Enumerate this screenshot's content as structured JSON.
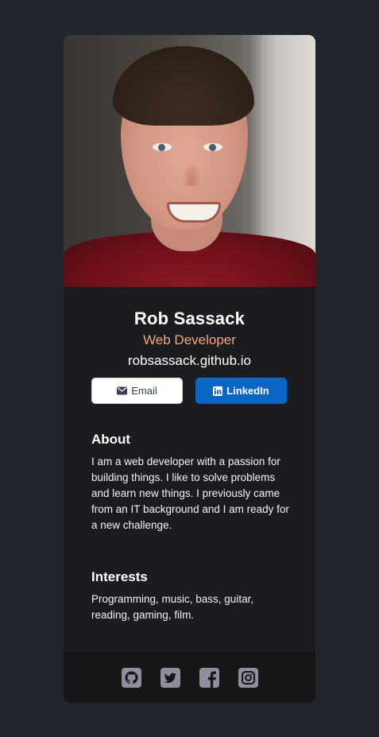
{
  "profile": {
    "name": "Rob Sassack",
    "title": "Web Developer",
    "website": "robsassack.github.io"
  },
  "buttons": {
    "email_label": "Email",
    "email_icon": "envelope-icon",
    "linkedin_label": "LinkedIn",
    "linkedin_icon": "linkedin-icon"
  },
  "about": {
    "heading": "About",
    "text": "I am a web developer with a passion for building things. I like to solve problems and learn new things. I previously came from an IT background and I am ready for a new challenge."
  },
  "interests": {
    "heading": "Interests",
    "text": "Programming, music, bass, guitar, reading, gaming, film."
  },
  "footer": {
    "icons": [
      "github-icon",
      "twitter-icon",
      "facebook-icon",
      "instagram-icon"
    ]
  },
  "colors": {
    "page_background": "#23252c",
    "card_background": "#1b1c1f",
    "footer_background": "#161619",
    "accent_title": "#f2a77e",
    "linkedin_blue": "#0a66c2",
    "social_icon": "#918e9b"
  }
}
